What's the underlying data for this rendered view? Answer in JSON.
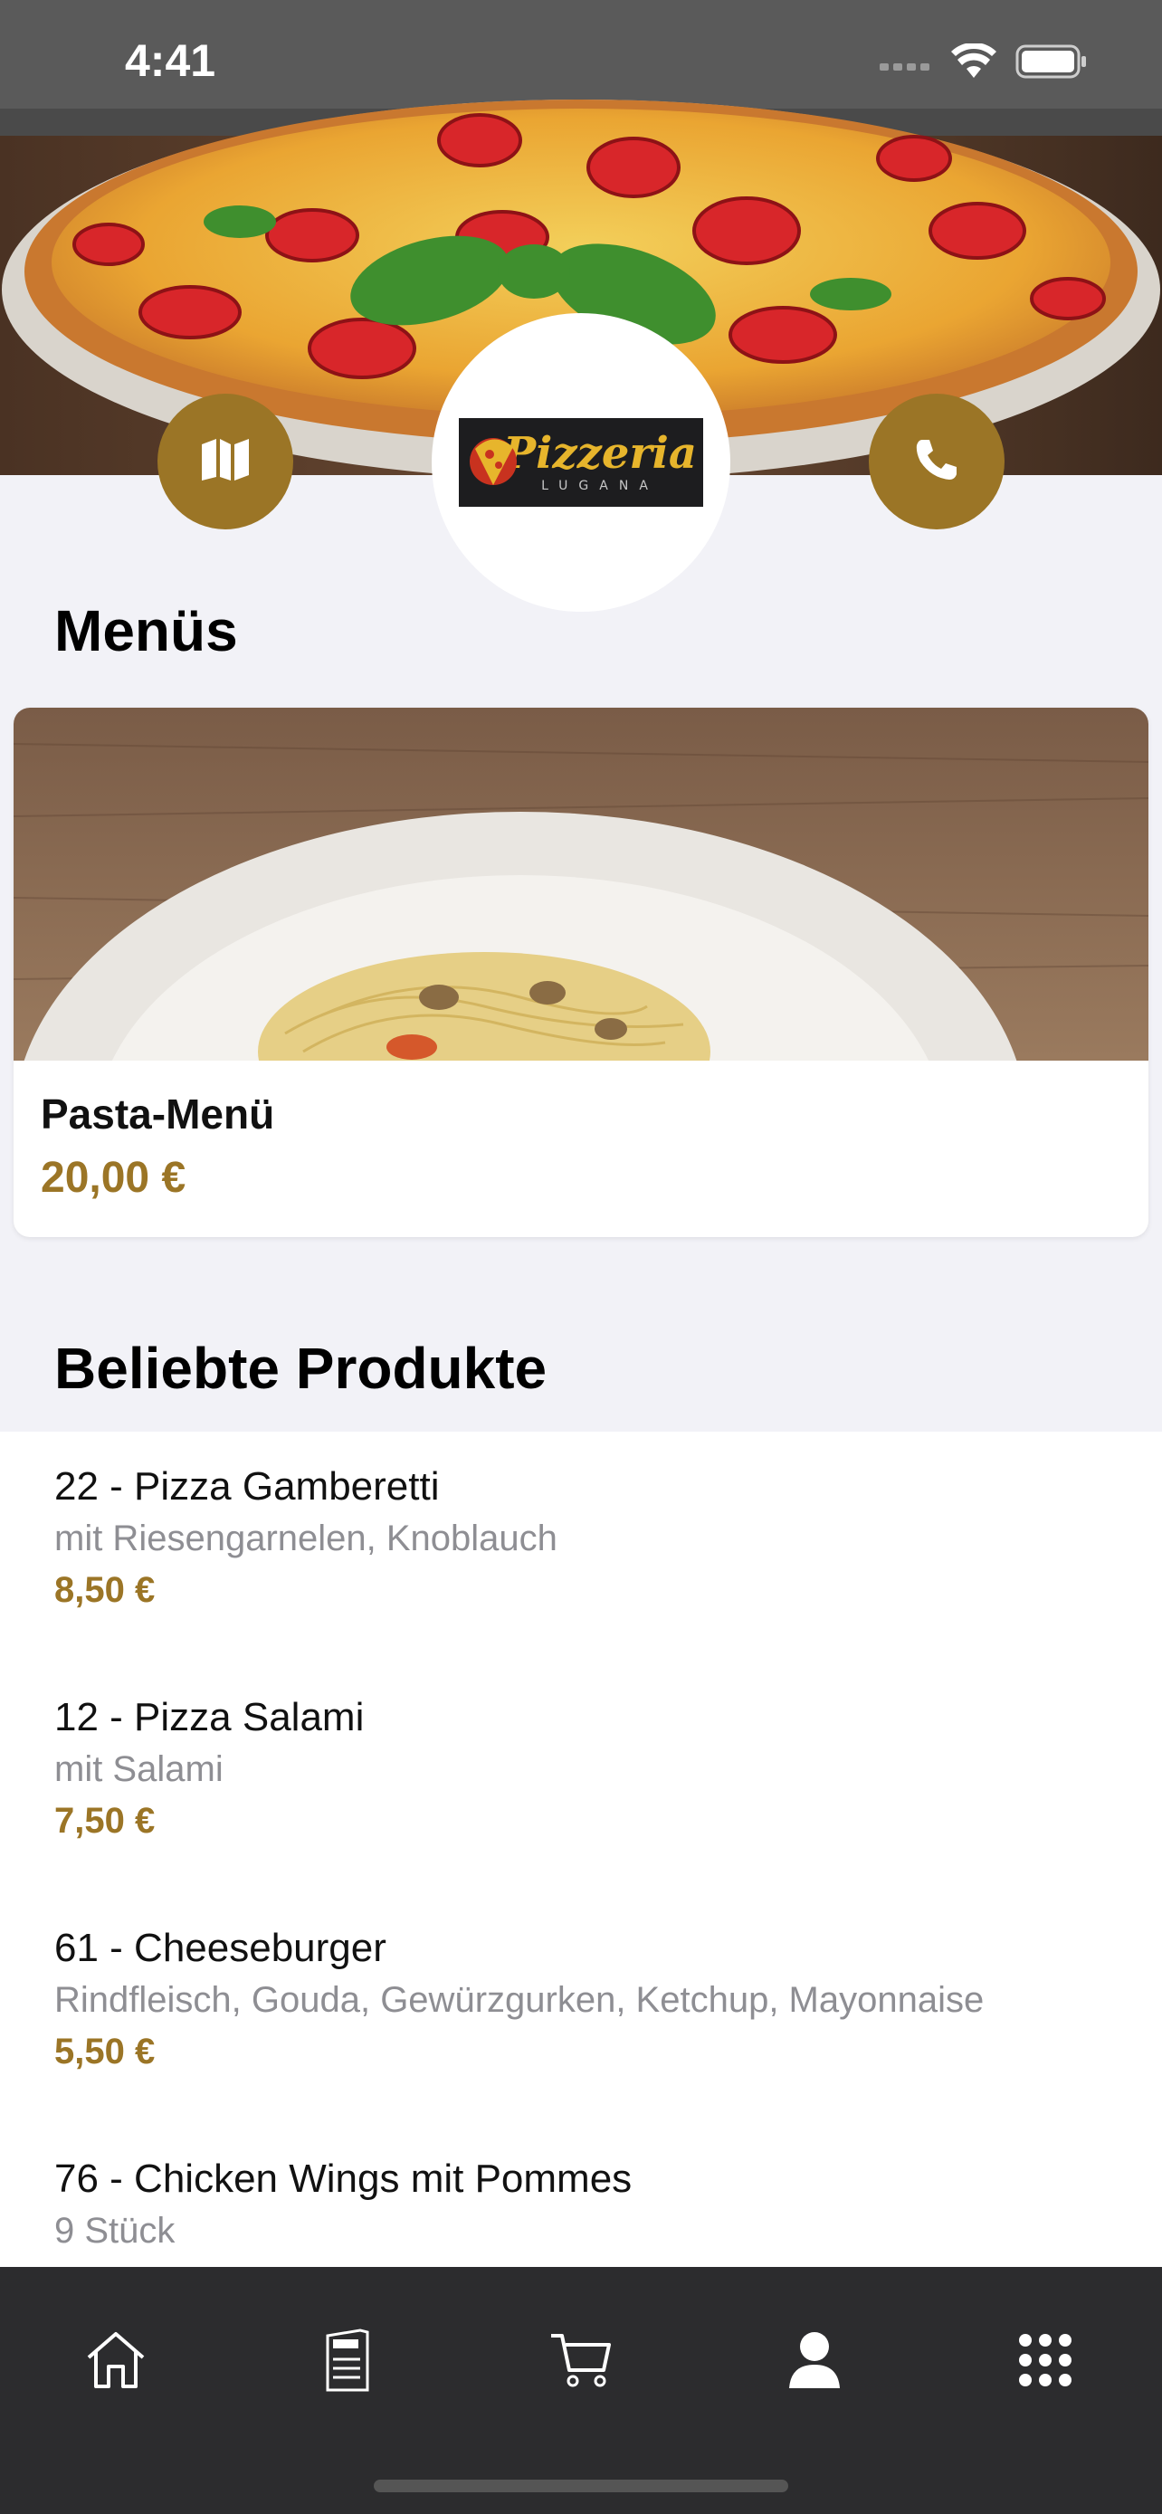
{
  "status_bar": {
    "time": "4:41"
  },
  "logo": {
    "title": "Pizzeria",
    "subtitle": "LUGANA"
  },
  "menus": {
    "title": "Menüs",
    "cards": [
      {
        "name": "Pasta-Menü",
        "price": "20,00 €"
      }
    ]
  },
  "popular": {
    "title": "Beliebte Produkte",
    "items": [
      {
        "name": "22 - Pizza Gamberetti",
        "description": "mit Riesengarnelen, Knoblauch",
        "price": "8,50 €"
      },
      {
        "name": "12 - Pizza Salami",
        "description": "mit Salami",
        "price": "7,50 €"
      },
      {
        "name": "61 - Cheeseburger",
        "description": "Rindfleisch, Gouda, Gewürzgurken, Ketchup, Mayonnaise",
        "price": "5,50 €"
      },
      {
        "name": "76 - Chicken Wings mit Pommes",
        "description": "9 Stück",
        "price": ""
      }
    ]
  },
  "tabbar": {
    "tabs": [
      {
        "icon": "home-icon"
      },
      {
        "icon": "menu-card-icon"
      },
      {
        "icon": "cart-icon"
      },
      {
        "icon": "profile-icon"
      },
      {
        "icon": "more-grid-icon"
      }
    ]
  },
  "colors": {
    "accent": "#9b7526",
    "tabbar": "#2c2c2e",
    "background": "#f2f2f7"
  }
}
